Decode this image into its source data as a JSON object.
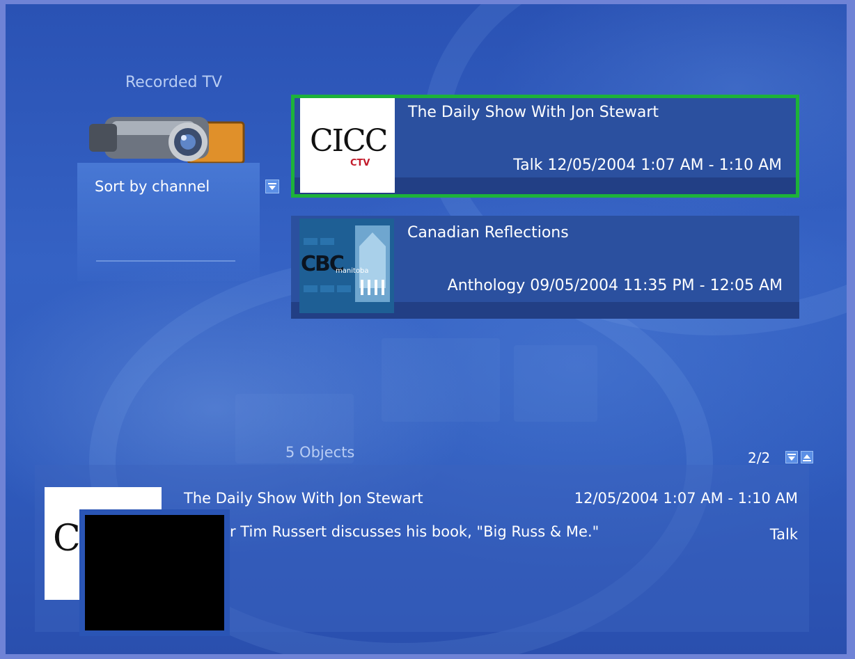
{
  "section": {
    "title": "Recorded TV"
  },
  "sort": {
    "label": "Sort by channel"
  },
  "recordings": [
    {
      "title": "The Daily Show With Jon Stewart",
      "meta": "Talk  12/05/2004 1:07 AM - 1:10 AM",
      "logo_text": "CICC",
      "logo_subtext": "CTV",
      "selected": true
    },
    {
      "title": "Canadian Reflections",
      "meta": "Anthology  09/05/2004 11:35 PM - 12:05 AM",
      "logo_text": "CBC",
      "logo_subtext": "manitoba",
      "selected": false
    }
  ],
  "status": {
    "count": "5 Objects",
    "page": "2/2"
  },
  "details": {
    "title": "The Daily Show With Jon Stewart",
    "datetime": "12/05/2004 1:07 AM - 1:10 AM",
    "description": "r Tim Russert discusses his book, \"Big Russ & Me.\"",
    "genre": "Talk",
    "logo_letter": "C"
  },
  "colors": {
    "selection": "#1db23a",
    "accent": "#5b8fe6"
  }
}
